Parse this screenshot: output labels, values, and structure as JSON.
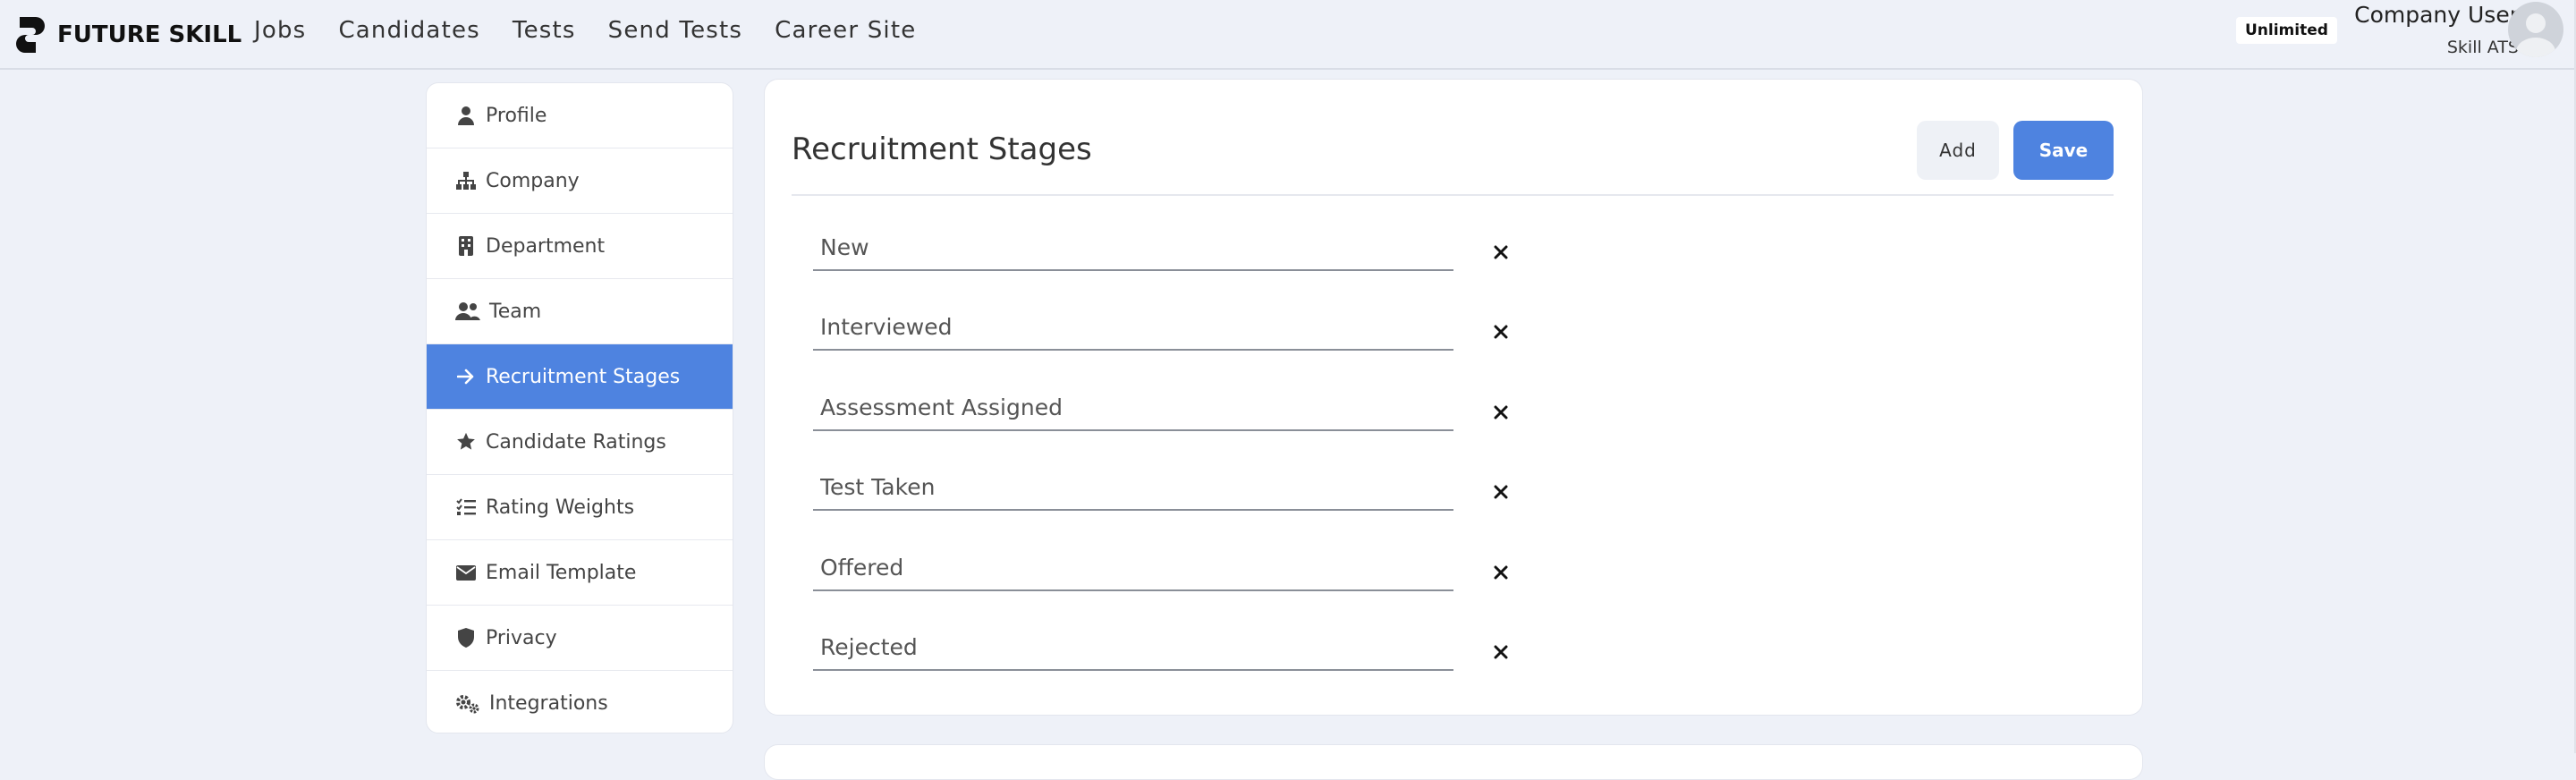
{
  "brand": {
    "name": "FUTURE SKILL",
    "icon": "future-skill-logo"
  },
  "nav": {
    "links": [
      {
        "label": "Jobs"
      },
      {
        "label": "Candidates"
      },
      {
        "label": "Tests"
      },
      {
        "label": "Send Tests"
      },
      {
        "label": "Career Site"
      }
    ]
  },
  "account": {
    "plan_badge": "Unlimited",
    "user_name": "Company User",
    "org_name": "Skill ATS",
    "avatar_icon": "user-avatar-icon"
  },
  "sidebar": {
    "items": [
      {
        "label": "Profile",
        "icon": "user-icon",
        "active": false
      },
      {
        "label": "Company",
        "icon": "sitemap-icon",
        "active": false
      },
      {
        "label": "Department",
        "icon": "building-icon",
        "active": false
      },
      {
        "label": "Team",
        "icon": "users-icon",
        "active": false
      },
      {
        "label": "Recruitment Stages",
        "icon": "arrow-right-icon",
        "active": true
      },
      {
        "label": "Candidate Ratings",
        "icon": "star-icon",
        "active": false
      },
      {
        "label": "Rating Weights",
        "icon": "list-check-icon",
        "active": false
      },
      {
        "label": "Email Template",
        "icon": "envelope-icon",
        "active": false
      },
      {
        "label": "Privacy",
        "icon": "shield-icon",
        "active": false
      },
      {
        "label": "Integrations",
        "icon": "gears-icon",
        "active": false
      }
    ]
  },
  "main": {
    "title": "Recruitment Stages",
    "add_label": "Add",
    "save_label": "Save",
    "stages": [
      {
        "value": "New"
      },
      {
        "value": "Interviewed"
      },
      {
        "value": "Assessment Assigned"
      },
      {
        "value": "Test Taken"
      },
      {
        "value": "Offered"
      },
      {
        "value": "Rejected"
      }
    ],
    "remove_icon": "close-icon"
  },
  "colors": {
    "accent": "#4e83e0",
    "page_bg": "#eef1f8",
    "card_bg": "#ffffff"
  }
}
